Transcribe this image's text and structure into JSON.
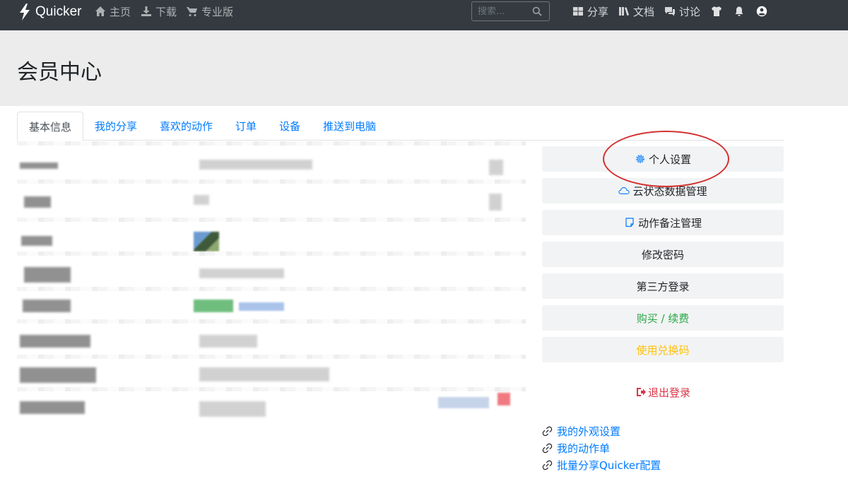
{
  "navbar": {
    "brand": "Quicker",
    "left_links": [
      {
        "label": "主页",
        "icon": "home-icon"
      },
      {
        "label": "下载",
        "icon": "download-icon"
      },
      {
        "label": "专业版",
        "icon": "cart-icon"
      }
    ],
    "search_placeholder": "搜索...",
    "right_links": [
      {
        "label": "分享",
        "icon": "grid-icon"
      },
      {
        "label": "文档",
        "icon": "books-icon"
      },
      {
        "label": "讨论",
        "icon": "comments-icon"
      }
    ],
    "right_icons": [
      "tshirt-icon",
      "bell-icon",
      "user-circle-icon"
    ]
  },
  "page_title": "会员中心",
  "tabs": [
    {
      "label": "基本信息",
      "active": true
    },
    {
      "label": "我的分享",
      "active": false
    },
    {
      "label": "喜欢的动作",
      "active": false
    },
    {
      "label": "订单",
      "active": false
    },
    {
      "label": "设备",
      "active": false
    },
    {
      "label": "推送到电脑",
      "active": false
    }
  ],
  "panel": {
    "personal_settings": "个人设置",
    "cloud_data": "云状态数据管理",
    "action_notes": "动作备注管理",
    "change_password": "修改密码",
    "third_party_login": "第三方登录",
    "buy_renew": "购买 / 续费",
    "redeem_code": "使用兑换码",
    "logout": "退出登录"
  },
  "links": [
    "我的外观设置",
    "我的动作单",
    "批量分享Quicker配置"
  ],
  "colors": {
    "navbar": "#343a40",
    "link": "#007bff",
    "green": "#28a745",
    "yellow": "#ffc107",
    "danger": "#dc3545",
    "annotation": "#d32f2f"
  }
}
